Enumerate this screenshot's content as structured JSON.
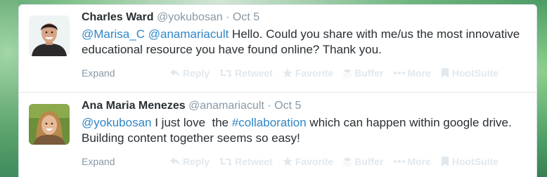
{
  "tweets": [
    {
      "fullname": "Charles Ward",
      "username": "@yokubosan",
      "separator": "·",
      "time": "Oct 5",
      "text_segments": [
        {
          "kind": "mention",
          "text": "@Marisa_C"
        },
        {
          "kind": "plain",
          "text": " "
        },
        {
          "kind": "mention",
          "text": "@anamariacult"
        },
        {
          "kind": "plain",
          "text": " Hello. Could you share with me/us the most innovative educational resource you have found online? Thank you."
        }
      ],
      "expand": "Expand"
    },
    {
      "fullname": "Ana Maria Menezes",
      "username": "@anamariacult",
      "separator": "·",
      "time": "Oct 5",
      "text_segments": [
        {
          "kind": "mention",
          "text": "@yokubosan"
        },
        {
          "kind": "plain",
          "text": " I just love  the "
        },
        {
          "kind": "hashtag",
          "text": "#collaboration"
        },
        {
          "kind": "plain",
          "text": " which can happen within google drive. Building content together seems so easy!"
        }
      ],
      "expand": "Expand"
    }
  ],
  "actions": {
    "reply": "Reply",
    "retweet": "Retweet",
    "favorite": "Favorite",
    "buffer": "Buffer",
    "more": "More",
    "hootsuite": "HootSuite"
  },
  "colors": {
    "link": "#2f86c6",
    "muted": "#8899a6",
    "action_faded": "#e1e8ed",
    "text": "#292f33"
  }
}
